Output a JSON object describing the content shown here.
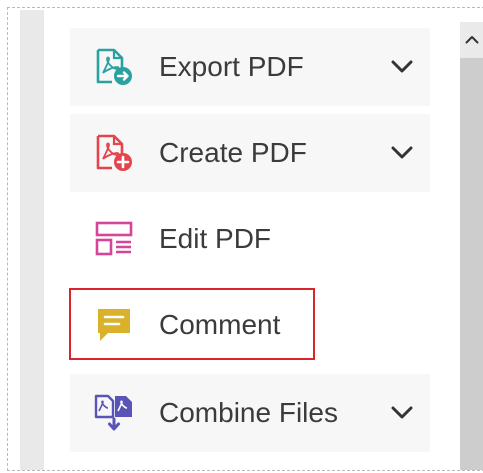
{
  "tools": [
    {
      "label": "Export PDF",
      "icon": "export-pdf-icon",
      "expandable": true,
      "color": "#2aa1a1"
    },
    {
      "label": "Create PDF",
      "icon": "create-pdf-icon",
      "expandable": true,
      "color": "#e4454d"
    },
    {
      "label": "Edit PDF",
      "icon": "edit-pdf-icon",
      "expandable": false,
      "color": "#d6459a"
    },
    {
      "label": "Comment",
      "icon": "comment-icon",
      "expandable": false,
      "color": "#d9b12a",
      "selected": true
    },
    {
      "label": "Combine Files",
      "icon": "combine-files-icon",
      "expandable": true,
      "color": "#5a54b8"
    }
  ],
  "scrollbar": {
    "up_icon": "chevron-up-icon"
  },
  "colors": {
    "selection_border": "#d9252c",
    "label_text": "#3b3b3b"
  }
}
